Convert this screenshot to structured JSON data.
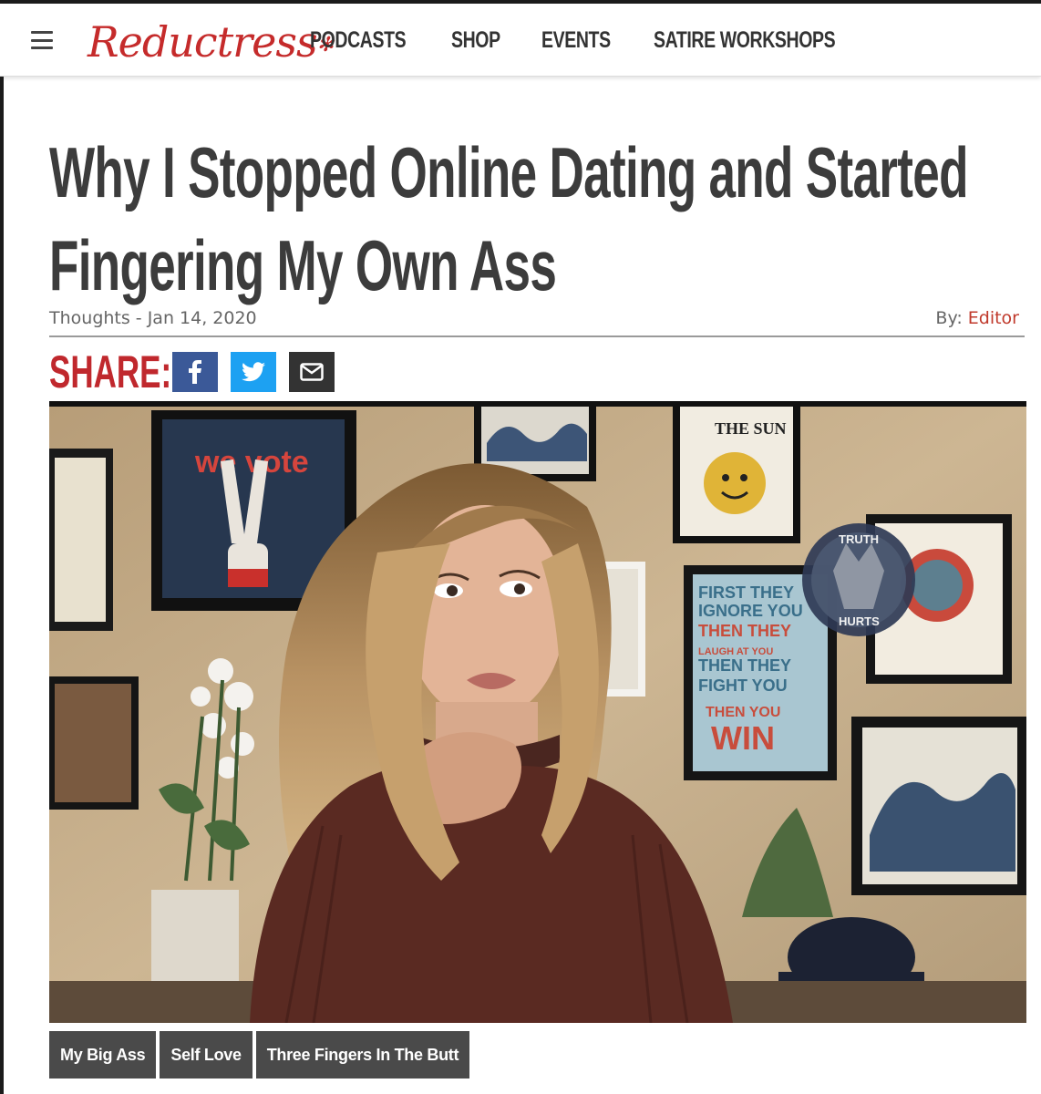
{
  "header": {
    "logo_text": "Reductress",
    "logo_star": "✻",
    "nav": [
      "PODCASTS",
      "SHOP",
      "EVENTS",
      "SATIRE WORKSHOPS"
    ]
  },
  "article": {
    "title_line1": "Why I Stopped Online Dating and Started",
    "title_line2": "Fingering My Own Ass",
    "category": "Thoughts",
    "separator": " - ",
    "date": "Jan 14, 2020",
    "by_label": "By: ",
    "author": "Editor"
  },
  "share": {
    "label": "SHARE:",
    "buttons": [
      {
        "icon": "facebook-icon",
        "color": "#3b5998"
      },
      {
        "icon": "twitter-icon",
        "color": "#1da1f2"
      },
      {
        "icon": "email-icon",
        "color": "#333333"
      }
    ]
  },
  "photo": {
    "poster_vote": "we vote",
    "poster_sun": "THE SUN",
    "poster_quote": [
      "FIRST THEY",
      "IGNORE YOU",
      "THEN THEY",
      "LAUGH AT YOU",
      "THEN THEY",
      "FIGHT YOU",
      "THEN YOU",
      "WIN"
    ],
    "watermark_top": "TRUTH",
    "watermark_bottom": "HURTS"
  },
  "tags": [
    "My Big Ass",
    "Self Love",
    "Three Fingers In The Butt"
  ],
  "colors": {
    "brand_red": "#c52b2b",
    "share_red": "#c0282d",
    "tag_bg": "#4a4a4a"
  }
}
